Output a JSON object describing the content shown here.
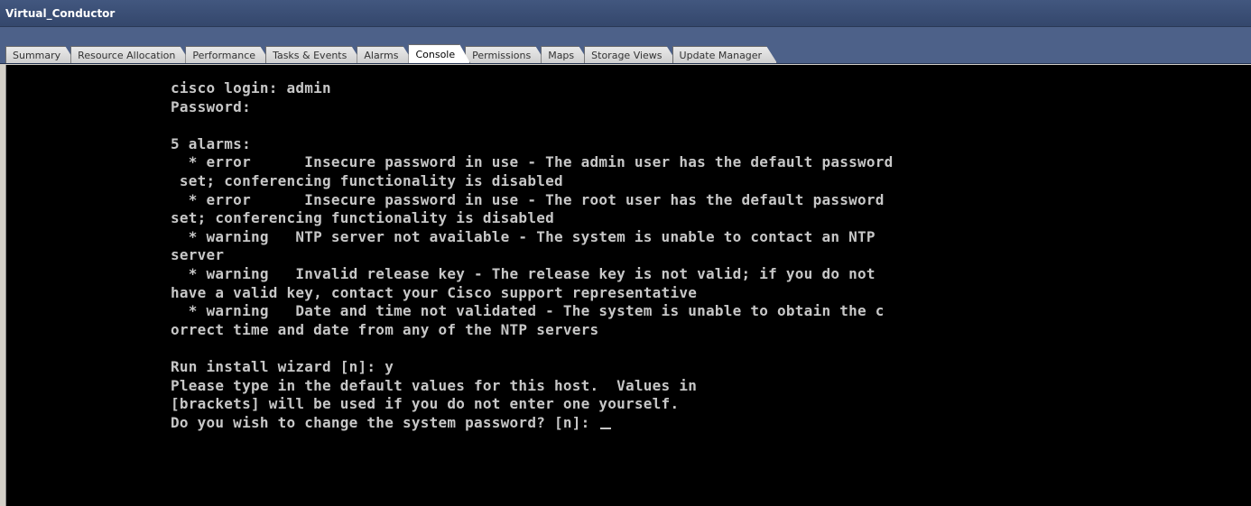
{
  "window": {
    "title": "Virtual_Conductor"
  },
  "tabs": [
    {
      "label": "Summary",
      "active": false
    },
    {
      "label": "Resource Allocation",
      "active": false
    },
    {
      "label": "Performance",
      "active": false
    },
    {
      "label": "Tasks & Events",
      "active": false
    },
    {
      "label": "Alarms",
      "active": false
    },
    {
      "label": "Console",
      "active": true
    },
    {
      "label": "Permissions",
      "active": false
    },
    {
      "label": "Maps",
      "active": false
    },
    {
      "label": "Storage Views",
      "active": false
    },
    {
      "label": "Update Manager",
      "active": false
    }
  ],
  "console": {
    "text": "cisco login: admin\nPassword:\n\n5 alarms:\n  * error      Insecure password in use - The admin user has the default password\n set; conferencing functionality is disabled\n  * error      Insecure password in use - The root user has the default password\nset; conferencing functionality is disabled\n  * warning   NTP server not available - The system is unable to contact an NTP\nserver\n  * warning   Invalid release key - The release key is not valid; if you do not\nhave a valid key, contact your Cisco support representative\n  * warning   Date and time not validated - The system is unable to obtain the c\norrect time and date from any of the NTP servers\n\nRun install wizard [n]: y\nPlease type in the default values for this host.  Values in\n[brackets] will be used if you do not enter one yourself.\nDo you wish to change the system password? [n]: "
  },
  "colors": {
    "titlebar_bg": "#3a4d74",
    "tabstrip_bg": "#4d6189",
    "console_bg": "#000000",
    "console_fg": "#c7c7c7"
  }
}
